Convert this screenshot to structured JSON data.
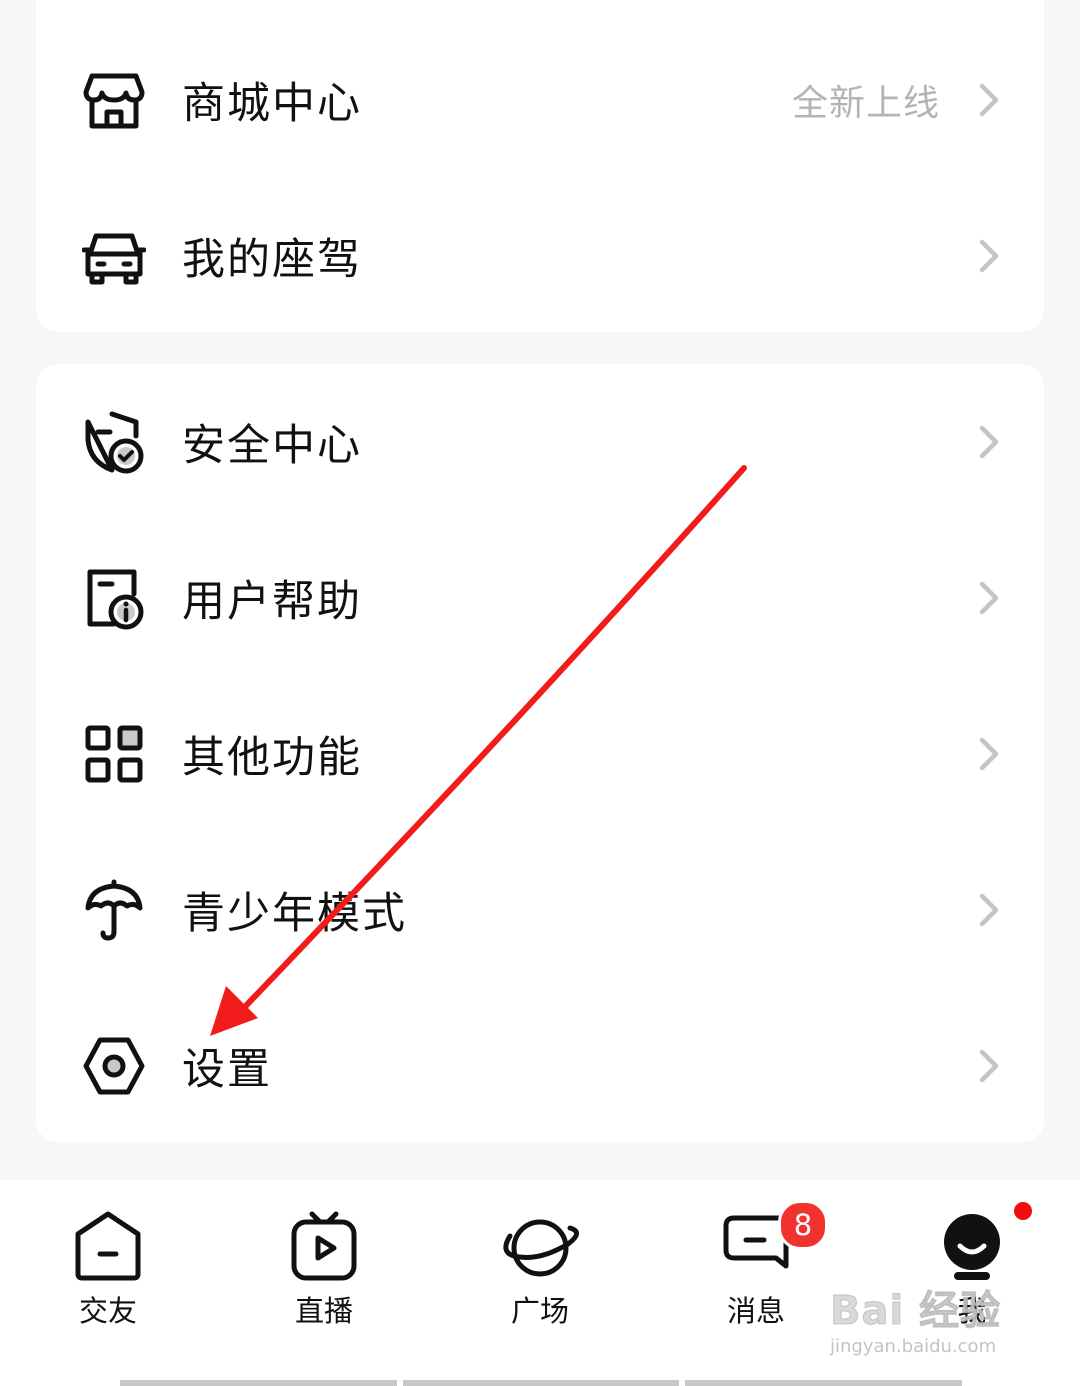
{
  "menu_groups": [
    {
      "items": [
        {
          "label": "商城中心",
          "extra": "全新上线",
          "icon": "store-icon"
        },
        {
          "label": "我的座驾",
          "extra": "",
          "icon": "car-icon"
        }
      ]
    },
    {
      "items": [
        {
          "label": "安全中心",
          "extra": "",
          "icon": "shield-check-icon"
        },
        {
          "label": "用户帮助",
          "extra": "",
          "icon": "help-doc-icon"
        },
        {
          "label": "其他功能",
          "extra": "",
          "icon": "grid-icon"
        },
        {
          "label": "青少年模式",
          "extra": "",
          "icon": "umbrella-icon"
        },
        {
          "label": "设置",
          "extra": "",
          "icon": "hex-gear-icon"
        }
      ]
    }
  ],
  "tabbar": {
    "tabs": [
      {
        "label": "交友",
        "icon": "home-icon"
      },
      {
        "label": "直播",
        "icon": "tv-icon"
      },
      {
        "label": "广场",
        "icon": "planet-icon"
      },
      {
        "label": "消息",
        "icon": "message-icon",
        "badge": "8"
      },
      {
        "label": "我",
        "icon": "profile-icon",
        "dot": true
      }
    ]
  },
  "watermark": {
    "main": "Bai 经验",
    "sub": "jingyan.baidu.com"
  },
  "colors": {
    "accent_red": "#f2322f",
    "annotation_arrow": "#f21c1c",
    "muted_text": "#b4b4b4",
    "background": "#f6f7f9"
  }
}
